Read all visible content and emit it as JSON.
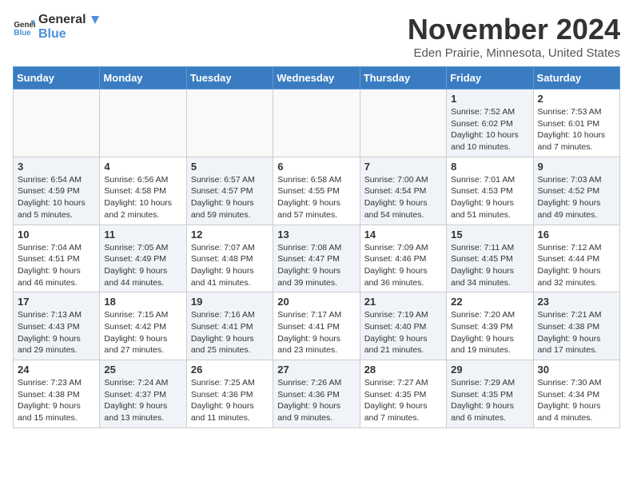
{
  "header": {
    "logo_general": "General",
    "logo_blue": "Blue",
    "month_title": "November 2024",
    "location": "Eden Prairie, Minnesota, United States"
  },
  "days_of_week": [
    "Sunday",
    "Monday",
    "Tuesday",
    "Wednesday",
    "Thursday",
    "Friday",
    "Saturday"
  ],
  "weeks": [
    [
      {
        "day": "",
        "info": "",
        "empty": true
      },
      {
        "day": "",
        "info": "",
        "empty": true
      },
      {
        "day": "",
        "info": "",
        "empty": true
      },
      {
        "day": "",
        "info": "",
        "empty": true
      },
      {
        "day": "",
        "info": "",
        "empty": true
      },
      {
        "day": "1",
        "info": "Sunrise: 7:52 AM\nSunset: 6:02 PM\nDaylight: 10 hours\nand 10 minutes.",
        "shaded": true
      },
      {
        "day": "2",
        "info": "Sunrise: 7:53 AM\nSunset: 6:01 PM\nDaylight: 10 hours\nand 7 minutes.",
        "shaded": false
      }
    ],
    [
      {
        "day": "3",
        "info": "Sunrise: 6:54 AM\nSunset: 4:59 PM\nDaylight: 10 hours\nand 5 minutes.",
        "shaded": true
      },
      {
        "day": "4",
        "info": "Sunrise: 6:56 AM\nSunset: 4:58 PM\nDaylight: 10 hours\nand 2 minutes.",
        "shaded": false
      },
      {
        "day": "5",
        "info": "Sunrise: 6:57 AM\nSunset: 4:57 PM\nDaylight: 9 hours\nand 59 minutes.",
        "shaded": true
      },
      {
        "day": "6",
        "info": "Sunrise: 6:58 AM\nSunset: 4:55 PM\nDaylight: 9 hours\nand 57 minutes.",
        "shaded": false
      },
      {
        "day": "7",
        "info": "Sunrise: 7:00 AM\nSunset: 4:54 PM\nDaylight: 9 hours\nand 54 minutes.",
        "shaded": true
      },
      {
        "day": "8",
        "info": "Sunrise: 7:01 AM\nSunset: 4:53 PM\nDaylight: 9 hours\nand 51 minutes.",
        "shaded": false
      },
      {
        "day": "9",
        "info": "Sunrise: 7:03 AM\nSunset: 4:52 PM\nDaylight: 9 hours\nand 49 minutes.",
        "shaded": true
      }
    ],
    [
      {
        "day": "10",
        "info": "Sunrise: 7:04 AM\nSunset: 4:51 PM\nDaylight: 9 hours\nand 46 minutes.",
        "shaded": false
      },
      {
        "day": "11",
        "info": "Sunrise: 7:05 AM\nSunset: 4:49 PM\nDaylight: 9 hours\nand 44 minutes.",
        "shaded": true
      },
      {
        "day": "12",
        "info": "Sunrise: 7:07 AM\nSunset: 4:48 PM\nDaylight: 9 hours\nand 41 minutes.",
        "shaded": false
      },
      {
        "day": "13",
        "info": "Sunrise: 7:08 AM\nSunset: 4:47 PM\nDaylight: 9 hours\nand 39 minutes.",
        "shaded": true
      },
      {
        "day": "14",
        "info": "Sunrise: 7:09 AM\nSunset: 4:46 PM\nDaylight: 9 hours\nand 36 minutes.",
        "shaded": false
      },
      {
        "day": "15",
        "info": "Sunrise: 7:11 AM\nSunset: 4:45 PM\nDaylight: 9 hours\nand 34 minutes.",
        "shaded": true
      },
      {
        "day": "16",
        "info": "Sunrise: 7:12 AM\nSunset: 4:44 PM\nDaylight: 9 hours\nand 32 minutes.",
        "shaded": false
      }
    ],
    [
      {
        "day": "17",
        "info": "Sunrise: 7:13 AM\nSunset: 4:43 PM\nDaylight: 9 hours\nand 29 minutes.",
        "shaded": true
      },
      {
        "day": "18",
        "info": "Sunrise: 7:15 AM\nSunset: 4:42 PM\nDaylight: 9 hours\nand 27 minutes.",
        "shaded": false
      },
      {
        "day": "19",
        "info": "Sunrise: 7:16 AM\nSunset: 4:41 PM\nDaylight: 9 hours\nand 25 minutes.",
        "shaded": true
      },
      {
        "day": "20",
        "info": "Sunrise: 7:17 AM\nSunset: 4:41 PM\nDaylight: 9 hours\nand 23 minutes.",
        "shaded": false
      },
      {
        "day": "21",
        "info": "Sunrise: 7:19 AM\nSunset: 4:40 PM\nDaylight: 9 hours\nand 21 minutes.",
        "shaded": true
      },
      {
        "day": "22",
        "info": "Sunrise: 7:20 AM\nSunset: 4:39 PM\nDaylight: 9 hours\nand 19 minutes.",
        "shaded": false
      },
      {
        "day": "23",
        "info": "Sunrise: 7:21 AM\nSunset: 4:38 PM\nDaylight: 9 hours\nand 17 minutes.",
        "shaded": true
      }
    ],
    [
      {
        "day": "24",
        "info": "Sunrise: 7:23 AM\nSunset: 4:38 PM\nDaylight: 9 hours\nand 15 minutes.",
        "shaded": false
      },
      {
        "day": "25",
        "info": "Sunrise: 7:24 AM\nSunset: 4:37 PM\nDaylight: 9 hours\nand 13 minutes.",
        "shaded": true
      },
      {
        "day": "26",
        "info": "Sunrise: 7:25 AM\nSunset: 4:36 PM\nDaylight: 9 hours\nand 11 minutes.",
        "shaded": false
      },
      {
        "day": "27",
        "info": "Sunrise: 7:26 AM\nSunset: 4:36 PM\nDaylight: 9 hours\nand 9 minutes.",
        "shaded": true
      },
      {
        "day": "28",
        "info": "Sunrise: 7:27 AM\nSunset: 4:35 PM\nDaylight: 9 hours\nand 7 minutes.",
        "shaded": false
      },
      {
        "day": "29",
        "info": "Sunrise: 7:29 AM\nSunset: 4:35 PM\nDaylight: 9 hours\nand 6 minutes.",
        "shaded": true
      },
      {
        "day": "30",
        "info": "Sunrise: 7:30 AM\nSunset: 4:34 PM\nDaylight: 9 hours\nand 4 minutes.",
        "shaded": false
      }
    ]
  ]
}
